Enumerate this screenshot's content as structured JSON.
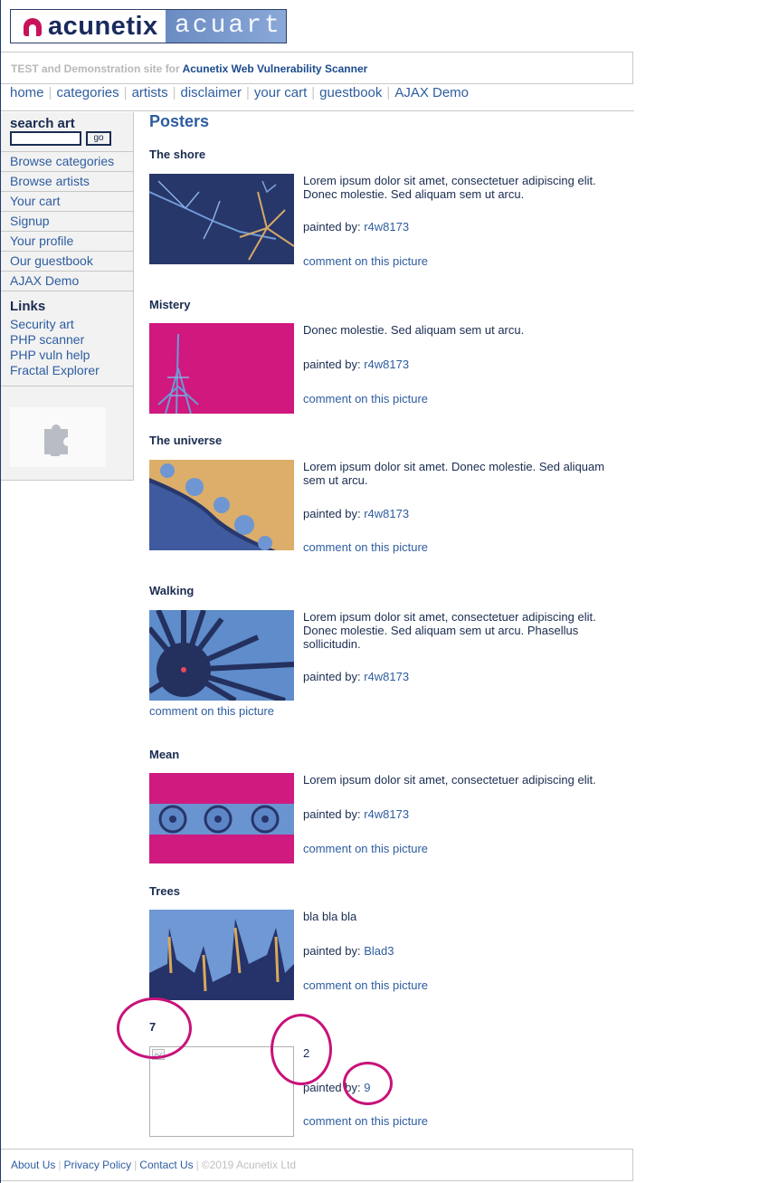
{
  "brand": {
    "left": "acunetix",
    "right": "acuart"
  },
  "tagline": {
    "prefix": "TEST and Demonstration site for ",
    "product": "Acunetix Web Vulnerability Scanner"
  },
  "topnav": [
    "home",
    "categories",
    "artists",
    "disclaimer",
    "your cart",
    "guestbook",
    "AJAX Demo"
  ],
  "sidebar": {
    "search_label": "search art",
    "search_value": "",
    "go_label": "go",
    "menu": [
      "Browse categories",
      "Browse artists",
      "Your cart",
      "Signup",
      "Your profile",
      "Our guestbook",
      "AJAX Demo"
    ],
    "links_heading": "Links",
    "links": [
      "Security art",
      "PHP scanner",
      "PHP vuln help",
      "Fractal Explorer"
    ]
  },
  "page_title": "Posters",
  "painted_by_label": "painted by: ",
  "comment_label": "comment on this picture",
  "posters": [
    {
      "title": "The shore",
      "description": "Lorem ipsum dolor sit amet, consectetuer adipiscing elit. Donec molestie. Sed aliquam sem ut arcu.",
      "artist": "r4w8173"
    },
    {
      "title": "Mistery",
      "description": "Donec molestie. Sed aliquam sem ut arcu.",
      "artist": "r4w8173"
    },
    {
      "title": "The universe",
      "description": "Lorem ipsum dolor sit amet. Donec molestie. Sed aliquam sem ut arcu.",
      "artist": "r4w8173"
    },
    {
      "title": "Walking",
      "description": "Lorem ipsum dolor sit amet, consectetuer adipiscing elit. Donec molestie. Sed aliquam sem ut arcu. Phasellus sollicitudin.",
      "artist": "r4w8173"
    },
    {
      "title": "Mean",
      "description": "Lorem ipsum dolor sit amet, consectetuer adipiscing elit.",
      "artist": "r4w8173"
    },
    {
      "title": "Trees",
      "description": "bla bla bla",
      "artist": "Blad3"
    },
    {
      "title": "7",
      "description": "2",
      "artist": "9"
    }
  ],
  "footer": {
    "links": [
      "About Us",
      "Privacy Policy",
      "Contact Us"
    ],
    "copyright": "©2019 Acunetix Ltd"
  },
  "colors": {
    "accent": "#2e5da0",
    "dark": "#1a2c50",
    "annotation": "#c8127a"
  }
}
